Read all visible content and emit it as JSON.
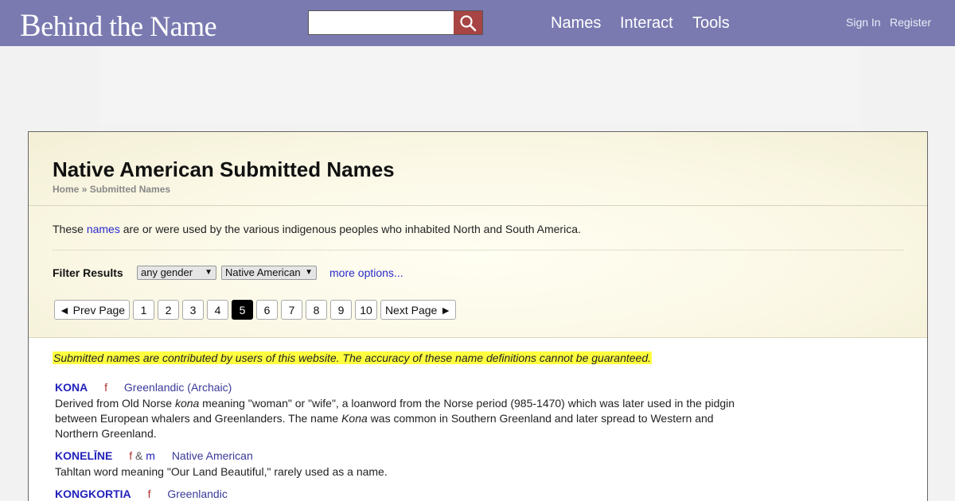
{
  "header": {
    "logo_initial": "B",
    "logo_rest": "ehind the Name",
    "search_placeholder": "",
    "nav": [
      "Names",
      "Interact",
      "Tools"
    ],
    "account": [
      "Sign In",
      "Register"
    ]
  },
  "page": {
    "title": "Native American Submitted Names",
    "breadcrumb": [
      "Home",
      "»",
      "Submitted Names"
    ],
    "intro_before": "These ",
    "intro_link": "names",
    "intro_after": " are or were used by the various indigenous peoples who inhabited North and South America."
  },
  "filter": {
    "label": "Filter Results",
    "gender_value": "any gender",
    "origin_value": "Native American",
    "more_options": "more options..."
  },
  "pagination": {
    "prev": "◄ Prev Page",
    "pages": [
      "1",
      "2",
      "3",
      "4",
      "5",
      "6",
      "7",
      "8",
      "9",
      "10"
    ],
    "current": "5",
    "next": "Next Page ►"
  },
  "disclaimer": "Submitted names are contributed by users of this website. The accuracy of these name definitions cannot be guaranteed.",
  "entries": [
    {
      "name": "KONA",
      "gender_f": "f",
      "usage": "Greenlandic (Archaic)",
      "desc_1": "Derived from Old Norse ",
      "desc_2": "kona",
      "desc_3": " meaning \"woman\" or \"wife\", a loanword from the Norse period (985-1470) which was later used in the pidgin between European whalers and Greenlanders. The name ",
      "desc_4": "Kona",
      "desc_5": " was common in Southern Greenland and later spread to Western and Northern Greenland."
    },
    {
      "name": "KONELĪNE",
      "gender_f": "f",
      "gender_amp": "&",
      "gender_m": "m",
      "usage": "Native American",
      "desc": "Tahltan word meaning \"Our Land Beautiful,\" rarely used as a name."
    },
    {
      "name": "KONGKORTIA",
      "gender_f": "f",
      "usage": "Greenlandic"
    }
  ],
  "colors": {
    "header_bg": "#7a7ab1",
    "search_button": "#a84444",
    "link": "#2a2acc",
    "name_link": "#2222bb",
    "female": "#b03030",
    "current_page_bg": "#000000",
    "highlight": "#ffff40"
  },
  "icons": {
    "search": "search-icon"
  }
}
